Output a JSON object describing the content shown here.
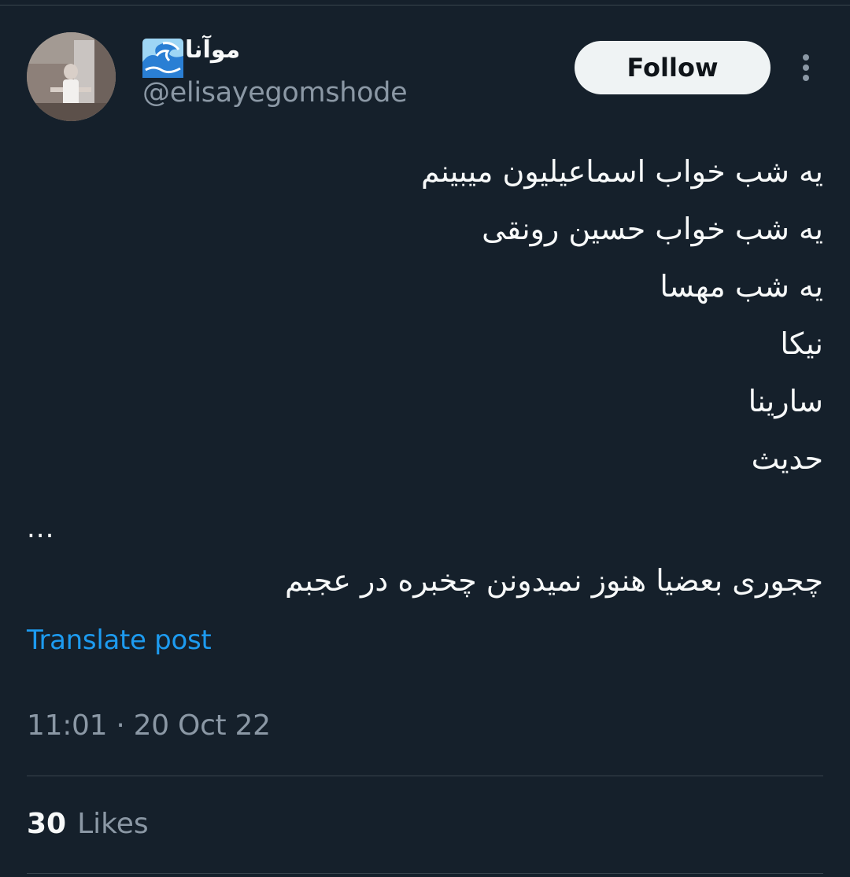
{
  "author": {
    "display_name": "موآنا",
    "display_emoji": "water-wave",
    "handle": "@elisayegomshode",
    "avatar_icon": "profile-photo"
  },
  "actions": {
    "follow_label": "Follow",
    "more_icon": "more-vertical-icon"
  },
  "tweet": {
    "lines": [
      "یه شب خواب اسماعیلیون میبینم",
      "یه شب خواب حسین رونقی",
      "یه شب مهسا",
      "نیکا",
      "سارینا",
      "حدیث"
    ],
    "ellipsis": "...",
    "last_line": "چجوری بعضیا هنوز نمیدونن چخبره در عجبم"
  },
  "translate_label": "Translate post",
  "timestamp": "11:01 · 20 Oct 22",
  "stats": {
    "likes_count": "30",
    "likes_label": "Likes"
  },
  "colors": {
    "background": "#15202b",
    "text_primary": "#f7f9f9",
    "text_secondary": "#8b98a5",
    "link": "#1d9bf0",
    "divider": "#38444d",
    "follow_bg": "#eff3f4"
  }
}
